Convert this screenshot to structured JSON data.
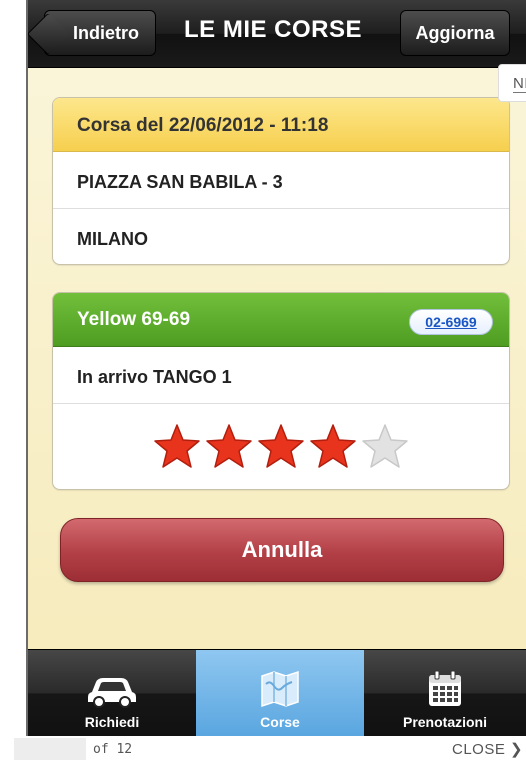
{
  "navbar": {
    "back_label": "Indietro",
    "title": "LE MIE CORSE",
    "refresh_label": "Aggiorna"
  },
  "overlay": {
    "next_label": "NEXT",
    "page_count": "of 12",
    "close_label": "CLOSE ❯"
  },
  "ride": {
    "header": "Corsa del 22/06/2012 - 11:18",
    "address": "PIAZZA SAN BABILA - 3",
    "city": "MILANO"
  },
  "taxi": {
    "name": "Yellow 69-69",
    "phone": "02-6969",
    "status": "In arrivo TANGO 1",
    "rating": 4,
    "rating_max": 5
  },
  "cancel_label": "Annulla",
  "tabs": [
    {
      "label": "Richiedi",
      "icon": "car-icon",
      "active": false
    },
    {
      "label": "Corse",
      "icon": "map-icon",
      "active": true
    },
    {
      "label": "Prenotazioni",
      "icon": "calendar-icon",
      "active": false
    }
  ],
  "colors": {
    "star_filled": "#e8341c",
    "star_empty": "#e2e2e2",
    "header_yellow": "#f6cf4e",
    "header_green": "#5aa82c",
    "cancel_red": "#b23f46",
    "tab_active": "#5aa6e0"
  }
}
